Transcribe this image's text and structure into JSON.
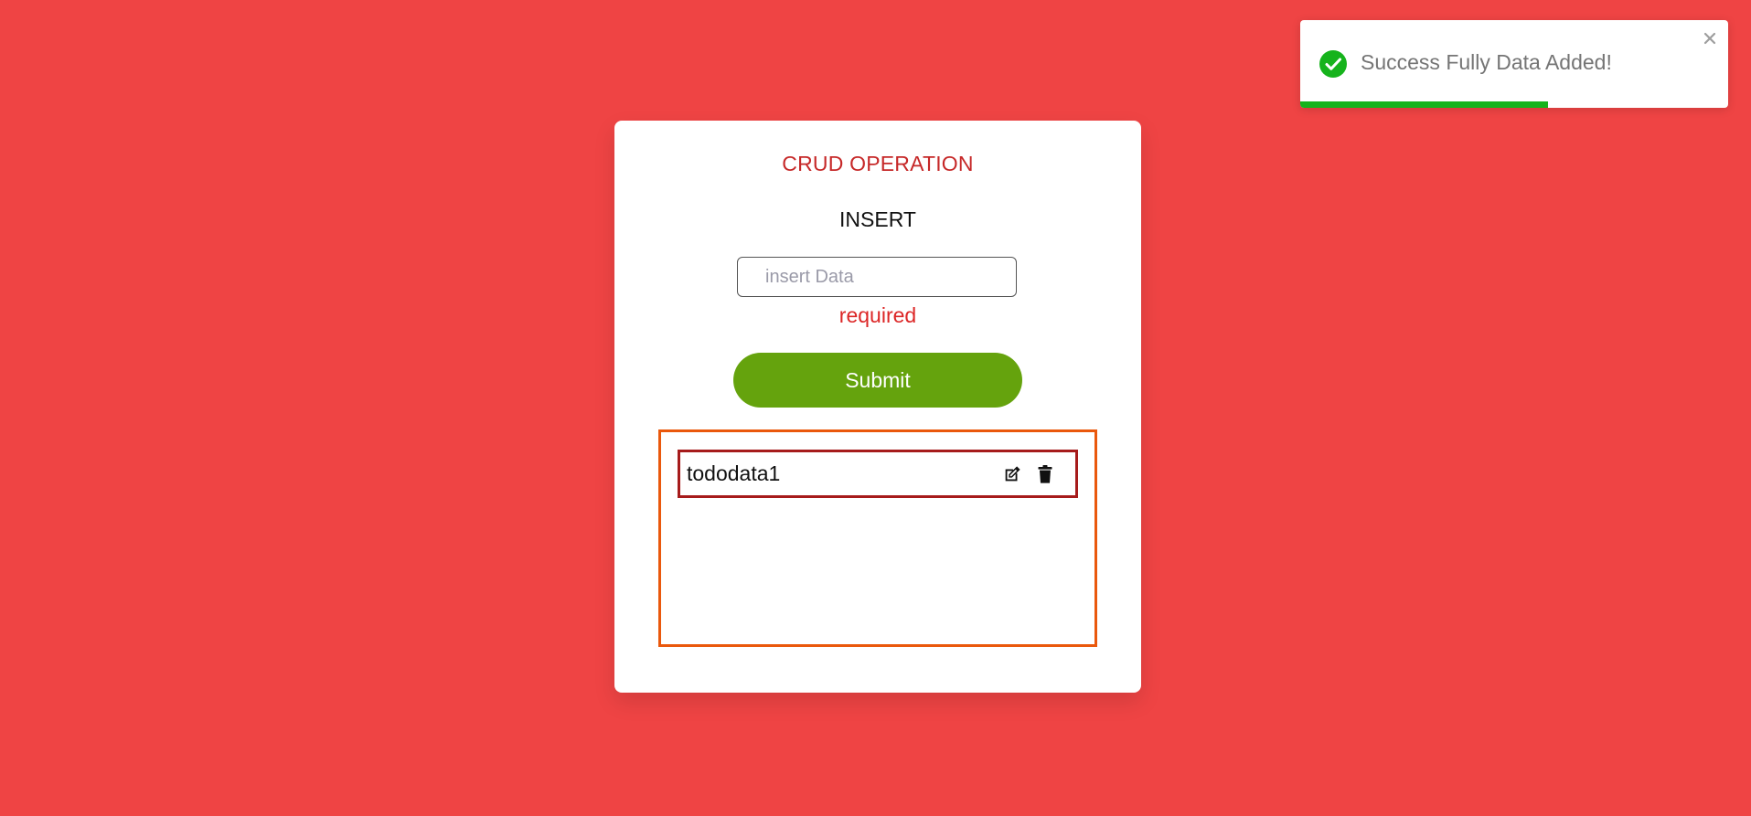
{
  "colors": {
    "page_background": "#ef4444",
    "title": "#c62828",
    "error": "#dc2626",
    "submit": "#65a30d",
    "list_border": "#ea580c",
    "item_border": "#a61b1b",
    "toast_success": "#16b31c"
  },
  "card": {
    "title": "CRUD OPERATION",
    "section_title": "INSERT",
    "input": {
      "placeholder": "insert Data",
      "value": ""
    },
    "error_text": "required",
    "submit_label": "Submit",
    "items": [
      {
        "text": "tododata1",
        "edit_icon": "edit-icon",
        "delete_icon": "trash-icon"
      }
    ]
  },
  "toast": {
    "message": "Success Fully Data Added!",
    "status_icon": "check-circle-icon",
    "close_icon": "close-icon",
    "progress_fraction": 0.58
  }
}
